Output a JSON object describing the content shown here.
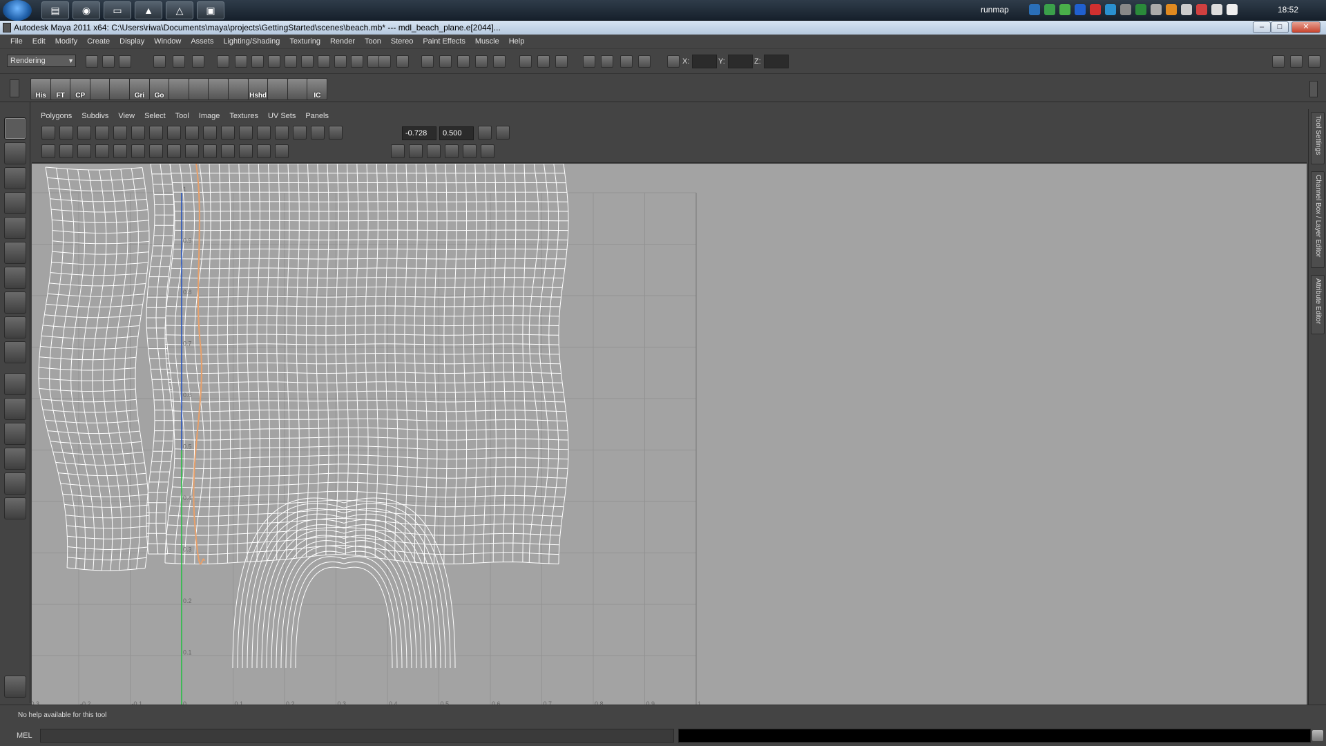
{
  "taskbar": {
    "apps": [
      "explorer",
      "firefox",
      "terminal",
      "maya-app",
      "vlc",
      "app"
    ],
    "tray_label": "runmap",
    "clock": "18:52"
  },
  "window": {
    "title": "Autodesk Maya 2011 x64: C:\\Users\\riwa\\Documents\\maya\\projects\\GettingStarted\\scenes\\beach.mb*   ---   mdl_beach_plane.e[2044]...",
    "minimize": "–",
    "maximize": "□",
    "close": "✕"
  },
  "menubar": [
    "File",
    "Edit",
    "Modify",
    "Create",
    "Display",
    "Window",
    "Assets",
    "Lighting/Shading",
    "Texturing",
    "Render",
    "Toon",
    "Stereo",
    "Paint Effects",
    "Muscle",
    "Help"
  ],
  "statusline": {
    "mode": "Rendering",
    "x_label": "X:",
    "y_label": "Y:",
    "z_label": "Z:"
  },
  "shelf": {
    "buttons": [
      {
        "label": "His",
        "icon": "history-icon"
      },
      {
        "label": "FT",
        "icon": "freeze-transform-icon"
      },
      {
        "label": "CP",
        "icon": "center-pivot-icon"
      },
      {
        "label": "",
        "icon": "uv-grid-icon"
      },
      {
        "label": "",
        "icon": "uv-layout-icon"
      },
      {
        "label": "Gri",
        "icon": "grid-icon"
      },
      {
        "label": "Go",
        "icon": "goto-icon"
      },
      {
        "label": "",
        "icon": "poly-plane-icon"
      },
      {
        "label": "",
        "icon": "texture-icon"
      },
      {
        "label": "",
        "icon": "unfold-icon"
      },
      {
        "label": "",
        "icon": "curve-icon"
      },
      {
        "label": "Hshd",
        "icon": "hypershade-icon"
      },
      {
        "label": "",
        "icon": "plane-icon"
      },
      {
        "label": "",
        "icon": "layers-icon"
      },
      {
        "label": "IC",
        "icon": "image-compare-icon"
      }
    ]
  },
  "uv_editor": {
    "menu": [
      "Polygons",
      "Subdivs",
      "View",
      "Select",
      "Tool",
      "Image",
      "Textures",
      "UV Sets",
      "Panels"
    ],
    "field_u": "-0.728",
    "field_v": "0.500",
    "u_ticks": [
      "-0.3",
      "-0.2",
      "-0.1",
      "0",
      "0.1",
      "0.2",
      "0.3",
      "0.4",
      "0.5",
      "0.6",
      "0.7",
      "0.8",
      "0.9",
      "1"
    ],
    "v_ticks": [
      "1",
      "0.9",
      "0.8",
      "0.7",
      "0.6",
      "0.5",
      "0.4",
      "0.3",
      "0.2",
      "0.1"
    ]
  },
  "side_tabs": [
    "Tool Settings",
    "Channel Box / Layer Editor",
    "Attribute Editor"
  ],
  "helpline": {
    "text": "No help available for this tool"
  },
  "cmdline": {
    "label": "MEL"
  },
  "colors": {
    "viewport_bg": "#a3a3a3",
    "wire": "#ffffff",
    "u_axis": "#e03030",
    "v_axis": "#20c040",
    "frame": "#2050c0"
  }
}
